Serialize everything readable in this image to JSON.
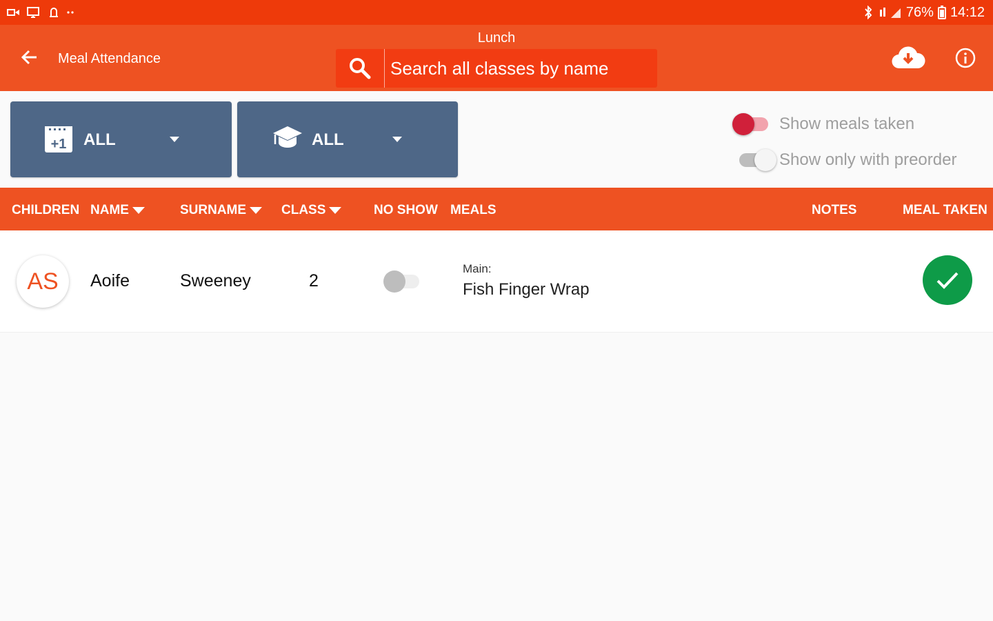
{
  "statusbar": {
    "battery": "76%",
    "time": "14:12",
    "icons": [
      "cast-icon",
      "screen-icon",
      "notification-icon",
      "bluetooth-icon",
      "signal-icon",
      "battery-icon"
    ]
  },
  "appbar": {
    "title": "Meal Attendance",
    "subtitle": "Lunch",
    "search_placeholder": "Search all classes by name"
  },
  "filters": {
    "date_label": "ALL",
    "class_label": "ALL"
  },
  "toggles": {
    "show_meals_taken": {
      "label": "Show meals taken",
      "on": true
    },
    "show_only_preorder": {
      "label": "Show only with preorder",
      "on": false
    }
  },
  "columns": {
    "children": "CHILDREN",
    "name": "NAME",
    "surname": "SURNAME",
    "class": "CLASS",
    "no_show": "NO SHOW",
    "meals": "MEALS",
    "notes": "NOTES",
    "meal_taken": "MEAL TAKEN"
  },
  "rows": [
    {
      "initials": "AS",
      "name": "Aoife",
      "surname": "Sweeney",
      "class": "2",
      "no_show": false,
      "meal_label": "Main:",
      "meal_value": "Fish Finger Wrap",
      "meal_taken": true
    }
  ],
  "colors": {
    "status_bar": "#ee3a0a",
    "primary": "#ee5222",
    "filter_button": "#4e6787",
    "toggle_on": "#d0203a",
    "meal_taken": "#0e9b48"
  }
}
